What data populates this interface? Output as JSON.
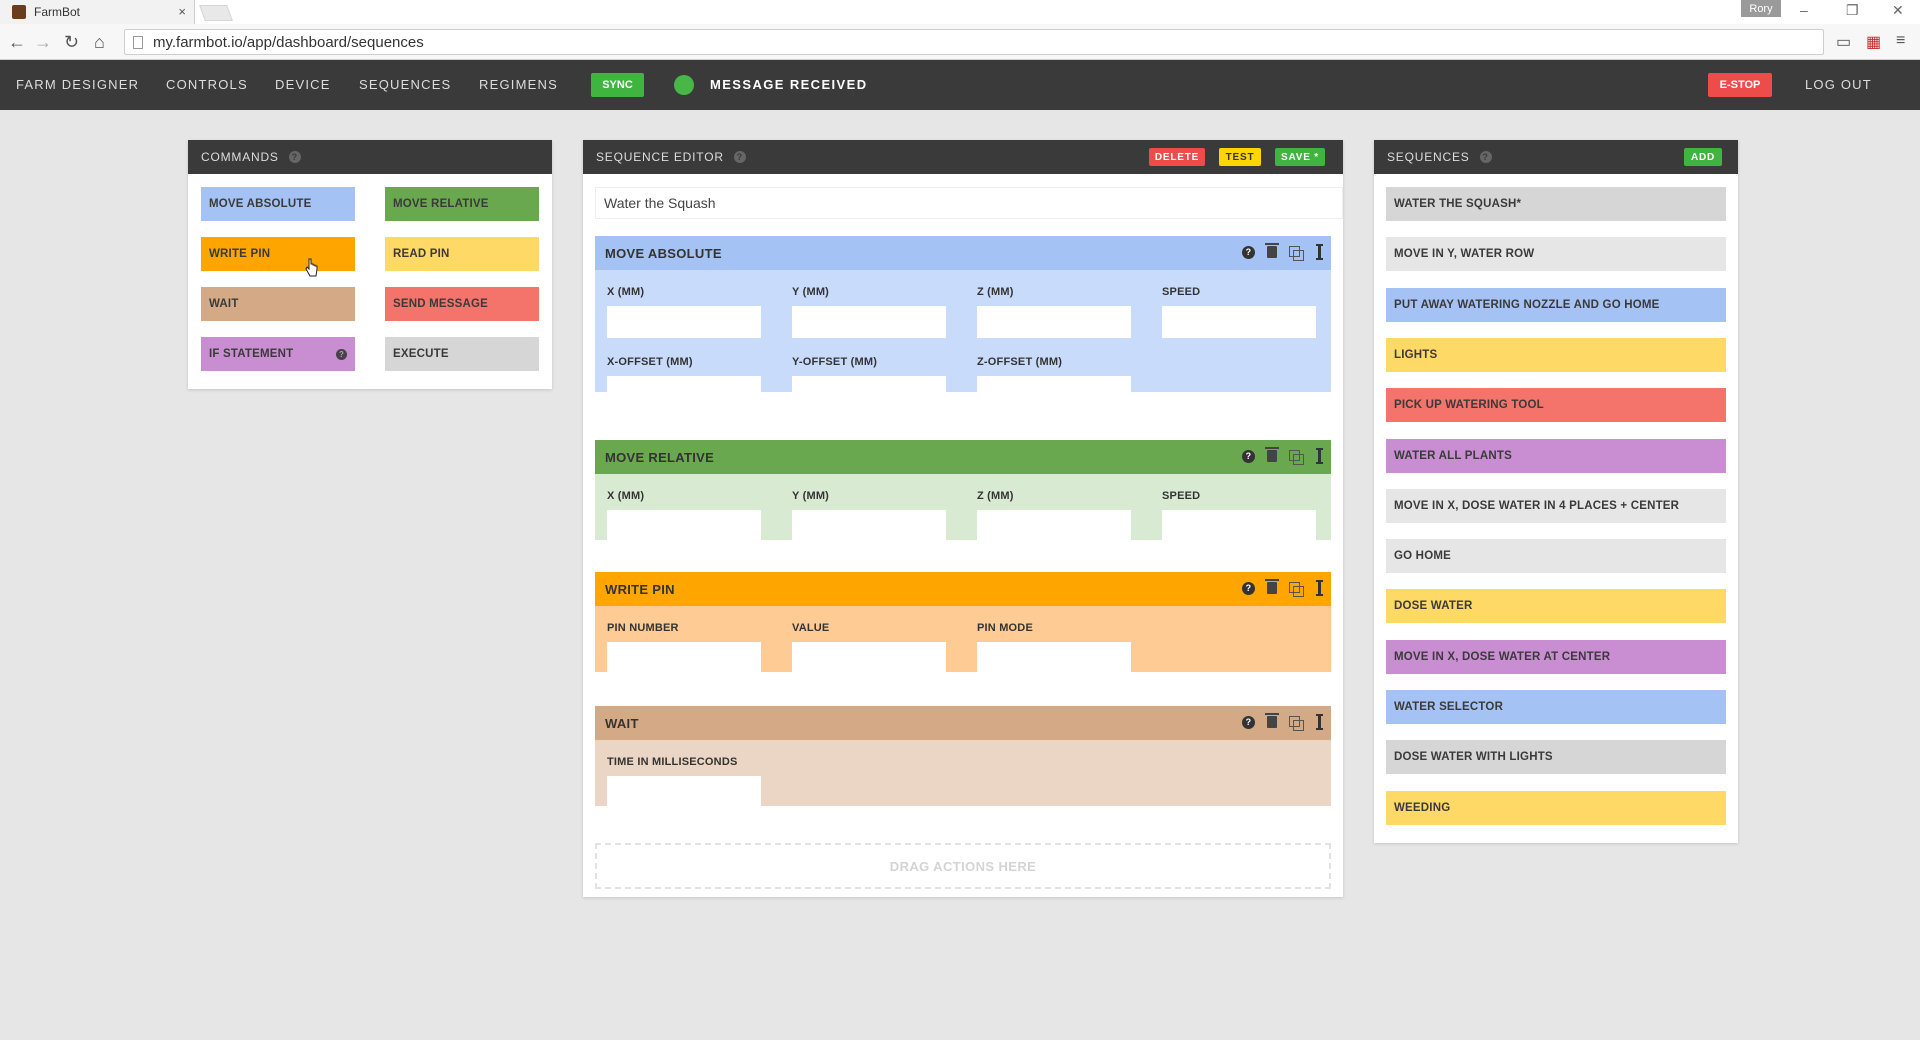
{
  "browser": {
    "tab_title": "FarmBot",
    "tab_close": "×",
    "user": "Rory",
    "url": "my.farmbot.io/app/dashboard/sequences",
    "back": "←",
    "forward": "→",
    "reload": "↻",
    "home": "⌂",
    "minimize": "–",
    "restore": "❐",
    "close": "✕"
  },
  "nav": {
    "links": [
      "FARM DESIGNER",
      "CONTROLS",
      "DEVICE",
      "SEQUENCES",
      "REGIMENS"
    ],
    "sync": "SYNC",
    "status": "MESSAGE RECEIVED",
    "estop": "E-STOP",
    "logout": "LOG OUT"
  },
  "commands": {
    "title": "COMMANDS",
    "items": [
      {
        "label": "MOVE ABSOLUTE",
        "color": "#a4c2f4"
      },
      {
        "label": "MOVE RELATIVE",
        "color": "#6aa84f"
      },
      {
        "label": "WRITE PIN",
        "color": "#ffa500"
      },
      {
        "label": "READ PIN",
        "color": "#ffd966"
      },
      {
        "label": "WAIT",
        "color": "#d4a985"
      },
      {
        "label": "SEND MESSAGE",
        "color": "#f4736b"
      },
      {
        "label": "IF STATEMENT",
        "color": "#c98ed1"
      },
      {
        "label": "EXECUTE",
        "color": "#d6d6d6"
      }
    ]
  },
  "editor": {
    "title": "SEQUENCE EDITOR",
    "delete": "DELETE",
    "test": "TEST",
    "save": "SAVE *",
    "name": "Water the Squash",
    "steps": [
      {
        "title": "MOVE ABSOLUTE",
        "head_color": "#a4c2f4",
        "body_color": "#c9dbfb",
        "fields": [
          "X (MM)",
          "Y (MM)",
          "Z (MM)",
          "SPEED",
          "X-OFFSET (MM)",
          "Y-OFFSET (MM)",
          "Z-OFFSET (MM)"
        ]
      },
      {
        "title": "MOVE RELATIVE",
        "head_color": "#6aa84f",
        "body_color": "#d9ead3",
        "fields": [
          "X (MM)",
          "Y (MM)",
          "Z (MM)",
          "SPEED"
        ]
      },
      {
        "title": "WRITE PIN",
        "head_color": "#ffa500",
        "body_color": "#ffcb95",
        "fields": [
          "PIN NUMBER",
          "VALUE",
          "PIN MODE"
        ]
      },
      {
        "title": "WAIT",
        "head_color": "#d4a985",
        "body_color": "#ebd6c5",
        "fields": [
          "TIME IN MILLISECONDS"
        ]
      }
    ],
    "dropzone": "DRAG ACTIONS HERE"
  },
  "sequences": {
    "title": "SEQUENCES",
    "add": "ADD",
    "items": [
      {
        "label": "WATER THE SQUASH*",
        "color": "#d6d6d6"
      },
      {
        "label": "MOVE IN Y, WATER ROW",
        "color": "#e6e6e6"
      },
      {
        "label": "PUT AWAY WATERING NOZZLE AND GO HOME",
        "color": "#a4c2f4"
      },
      {
        "label": "LIGHTS",
        "color": "#ffd966"
      },
      {
        "label": "PICK UP WATERING TOOL",
        "color": "#f4736b"
      },
      {
        "label": "WATER ALL PLANTS",
        "color": "#c98ed1"
      },
      {
        "label": "MOVE IN X, DOSE WATER IN 4 PLACES + CENTER",
        "color": "#e6e6e6"
      },
      {
        "label": "GO HOME",
        "color": "#e6e6e6"
      },
      {
        "label": "DOSE WATER",
        "color": "#ffd966"
      },
      {
        "label": "MOVE IN X, DOSE WATER AT CENTER",
        "color": "#c98ed1"
      },
      {
        "label": "WATER SELECTOR",
        "color": "#a4c2f4"
      },
      {
        "label": "DOSE WATER WITH LIGHTS",
        "color": "#d6d6d6"
      },
      {
        "label": "WEEDING",
        "color": "#ffd966"
      }
    ]
  },
  "colors": {
    "delete": "#ee4b4b",
    "test": "#ffd500",
    "save": "#3fb540",
    "add": "#3fb540"
  }
}
